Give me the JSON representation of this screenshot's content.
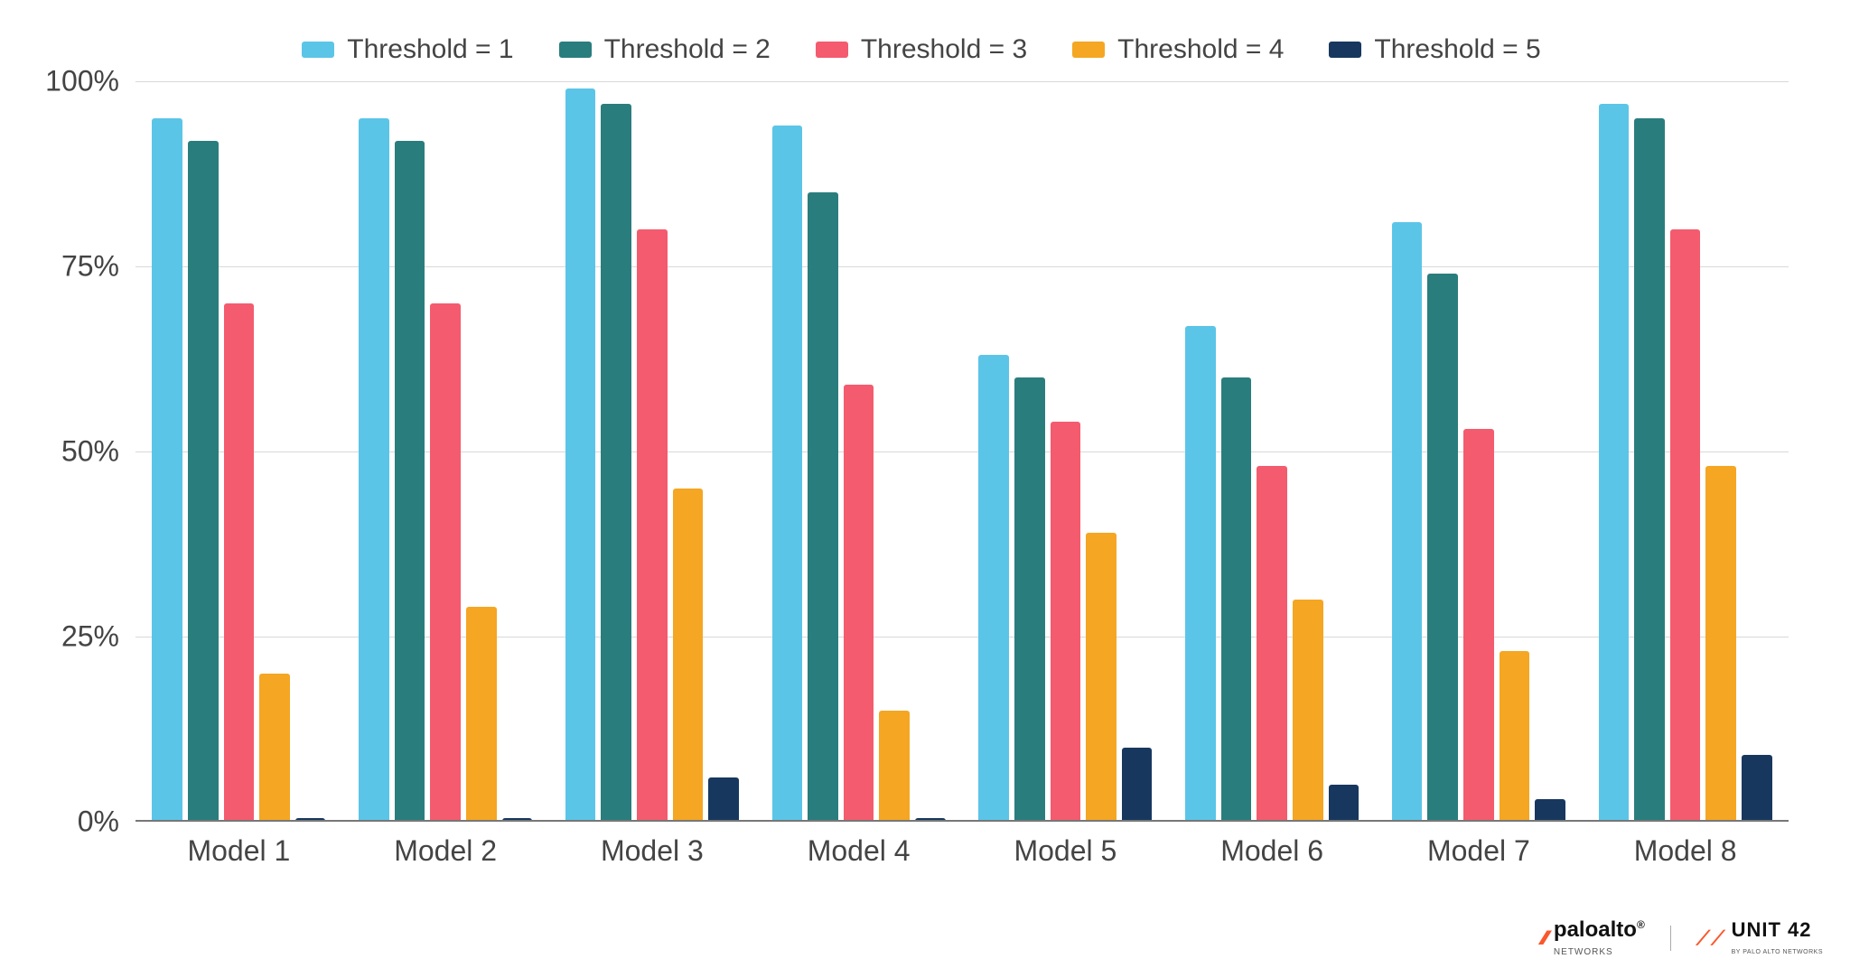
{
  "chart_data": {
    "type": "bar",
    "categories": [
      "Model 1",
      "Model 2",
      "Model 3",
      "Model 4",
      "Model 5",
      "Model 6",
      "Model 7",
      "Model 8"
    ],
    "series": [
      {
        "name": "Threshold = 1",
        "color": "#5bc5e8",
        "values": [
          95,
          95,
          99,
          94,
          63,
          67,
          81,
          97
        ]
      },
      {
        "name": "Threshold = 2",
        "color": "#2a7d7d",
        "values": [
          92,
          92,
          97,
          85,
          60,
          60,
          74,
          95
        ]
      },
      {
        "name": "Threshold = 3",
        "color": "#f45b6e",
        "values": [
          70,
          70,
          80,
          59,
          54,
          48,
          53,
          80
        ]
      },
      {
        "name": "Threshold = 4",
        "color": "#f5a623",
        "values": [
          20,
          29,
          45,
          15,
          39,
          30,
          23,
          48
        ]
      },
      {
        "name": "Threshold = 5",
        "color": "#17375e",
        "values": [
          0.5,
          0.5,
          6,
          0.5,
          10,
          5,
          3,
          9
        ]
      }
    ],
    "ylim": [
      0,
      100
    ],
    "yticks": [
      0,
      25,
      50,
      75,
      100
    ],
    "ytick_labels": [
      "0%",
      "25%",
      "50%",
      "75%",
      "100%"
    ],
    "xlabel": "",
    "ylabel": "",
    "title": ""
  },
  "footer": {
    "brand1": "paloalto",
    "brand1_sub": "NETWORKS",
    "brand1_trademark": "®",
    "brand2": "UNIT 42",
    "brand2_sub": "BY PALO ALTO NETWORKS"
  }
}
